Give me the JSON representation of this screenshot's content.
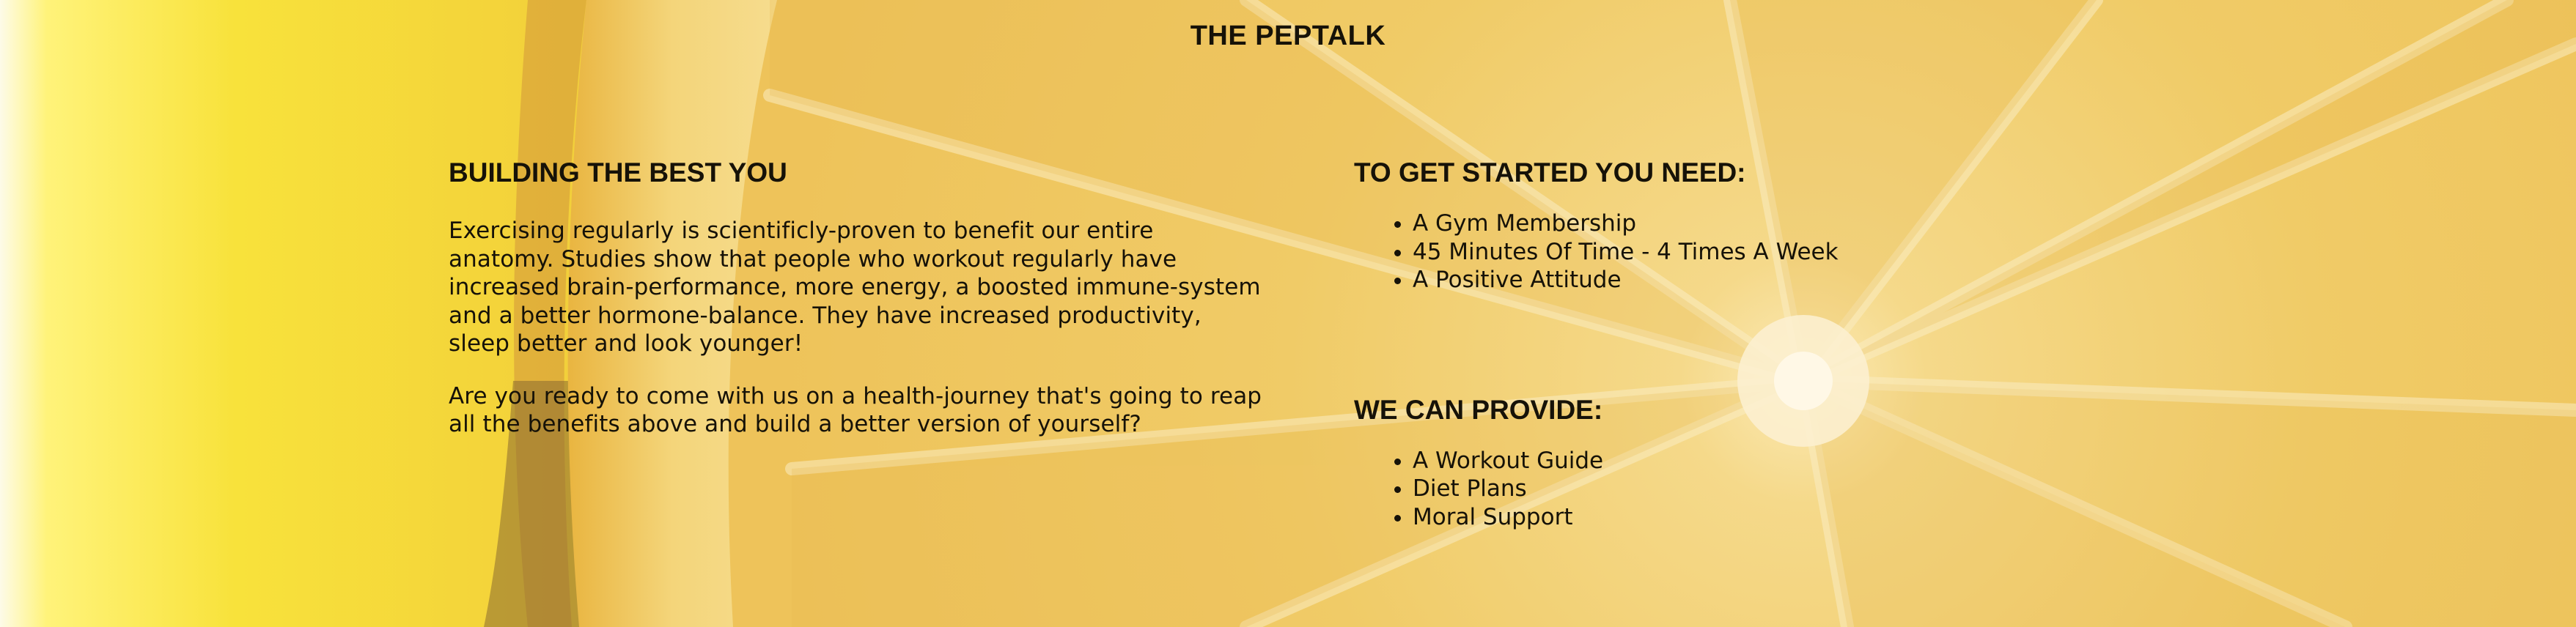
{
  "site": {
    "title": "THE PEPTALK"
  },
  "left_column": {
    "heading": "BUILDING THE BEST YOU",
    "paragraphs": [
      "Exercising regularly is scientificly-proven to benefit our entire anatomy. Studies show that people who workout regularly have increased brain-performance, more energy, a boosted immune-system and a better hormone-balance. They have increased productivity, sleep better and look younger!",
      "Are you ready to come with us on a health-journey that's going to reap all the benefits above and build a better version of yourself?"
    ]
  },
  "right_column": {
    "requirements": {
      "heading": "TO GET STARTED YOU NEED:",
      "items": [
        "A Gym Membership",
        "45 Minutes Of Time - 4 Times A Week",
        "A Positive Attitude"
      ]
    },
    "provisions": {
      "heading": "WE CAN PROVIDE:",
      "items": [
        "A Workout Guide",
        "Diet Plans",
        "Moral Support"
      ]
    }
  },
  "colors": {
    "background_main": "#f1cb64",
    "background_light": "#f7e08a",
    "text": "#161208"
  },
  "background_image": "lemon-slice-photo"
}
